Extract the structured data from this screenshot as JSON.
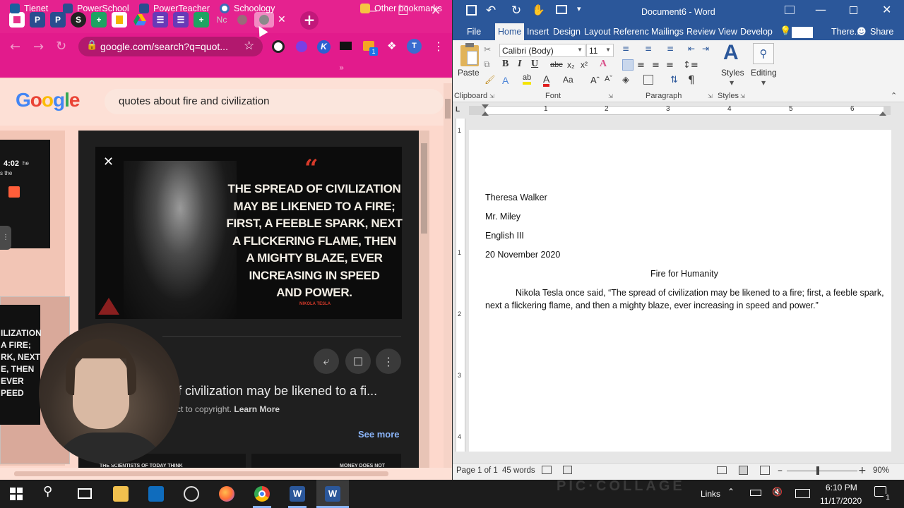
{
  "chrome": {
    "tabs": [
      "P",
      "P",
      "S",
      "+",
      "Nc"
    ],
    "new_tab_icon": "+",
    "tab_close": "✕",
    "address": "google.com/search?q=quot...",
    "bookmarks": [
      "Tienet",
      "PowerSchool",
      "PowerTeacher",
      "Schoology"
    ],
    "other_bookmarks": "Other bookmarks",
    "profile_initial": "T",
    "extension_badge": "1"
  },
  "google": {
    "logo": "Google",
    "query": "quotes about fire and civilization",
    "timer": "4:02",
    "side_text": [
      "CIVILIZATION",
      "ILIZATION",
      "A FIRE;",
      "RK, NEXT",
      "E, THEN",
      "EVER",
      "PEED"
    ],
    "quote_lines": [
      "THE SPREAD OF CIVILIZATION",
      "MAY BE LIKENED TO A FIRE;",
      "FIRST, A FEEBLE SPARK, NEXT",
      "A FLICKERING FLAME, THEN",
      "A MIGHTY BLAZE, EVER",
      "INCREASING IN SPEED",
      "AND POWER."
    ],
    "quote_author": "NIKOLA TESLA",
    "caption": "f civilization may be likened to a fi...",
    "copyright": "ct to copyright.",
    "learn_more": "Learn More",
    "see_more": "See more",
    "thumb_text_1": "THE SCIENTISTS OF TODAY THINK",
    "thumb_text_2": "MONEY DOES NOT"
  },
  "word": {
    "title": "Document6 - Word",
    "tabs": [
      "File",
      "Home",
      "Insert",
      "Design",
      "Layout",
      "Referenc",
      "Mailings",
      "Review",
      "View",
      "Develop"
    ],
    "user": "There...",
    "share": "Share",
    "font_name": "Calibri (Body)",
    "font_size": "11",
    "groups": [
      "Clipboard",
      "Font",
      "Paragraph",
      "Styles"
    ],
    "paste_label": "Paste",
    "styles_label": "Styles",
    "editing_label": "Editing",
    "ruler_numbers": [
      "1",
      "2",
      "3",
      "4",
      "5",
      "6"
    ],
    "document": {
      "lines": [
        "Theresa Walker",
        "Mr. Miley",
        "English III",
        "20 November 2020"
      ],
      "title": "Fire for Humanity",
      "para_line1": "Nikola Tesla once said, “The spread of civilization may be likened to a fire; first, a feeble spark,",
      "para_line2": "next a flickering flame, and then a mighty blaze, ever increasing in speed and power.”"
    },
    "status": {
      "page": "Page 1 of 1",
      "words": "45 words",
      "zoom": "90%"
    }
  },
  "taskbar": {
    "links": "Links",
    "time": "6:10 PM",
    "date": "11/17/2020",
    "notification_count": "1",
    "watermark": "PIC·COLLAGE"
  }
}
